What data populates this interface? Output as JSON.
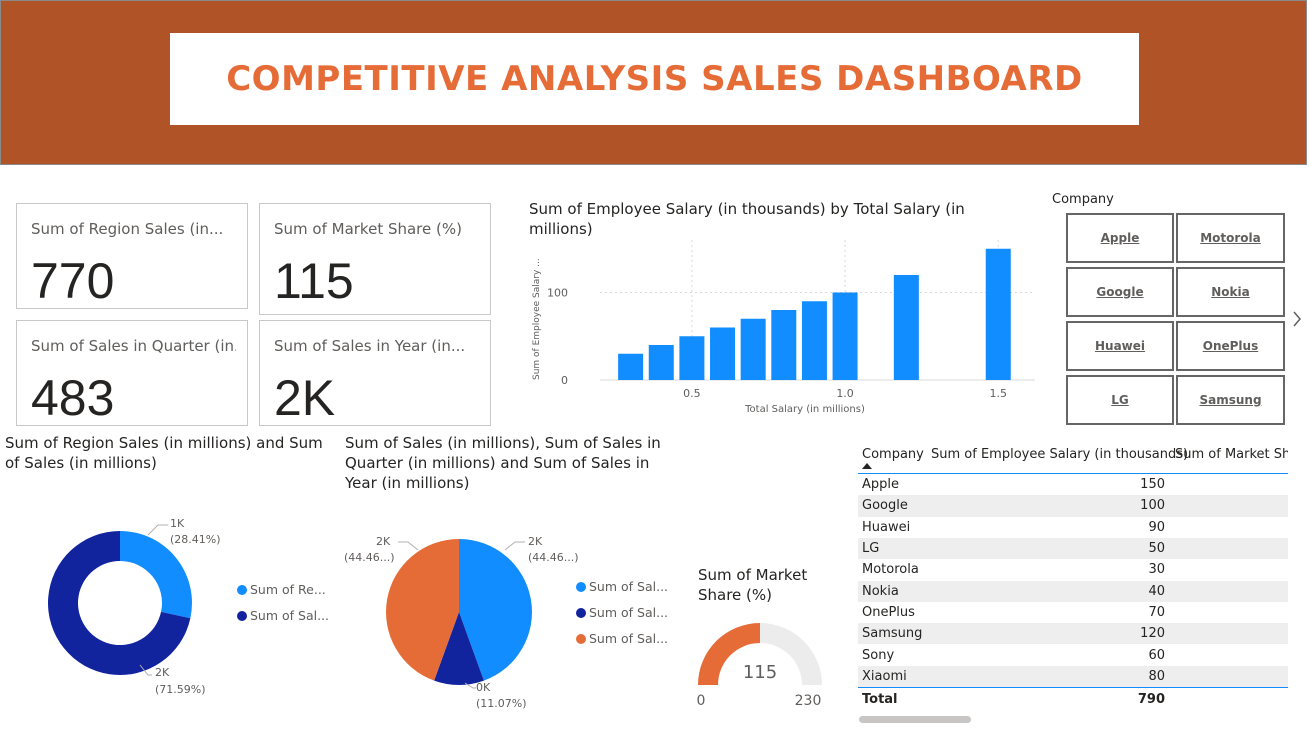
{
  "header": {
    "title": "COMPETITIVE ANALYSIS SALES DASHBOARD"
  },
  "cards": [
    {
      "label": "Sum of Region Sales (in...",
      "value": "770"
    },
    {
      "label": "Sum of Market Share (%)",
      "value": "115"
    },
    {
      "label": "Sum of Sales in Quarter (in...",
      "value": "483"
    },
    {
      "label": "Sum of Sales in Year (in...",
      "value": "2K"
    }
  ],
  "bar_chart": {
    "title_line1": "Sum of Employee Salary (in thousands) by Total Salary (in",
    "title_line2": "millions)",
    "xlabel": "Total Salary (in millions)",
    "ylabel": "Sum of Employee Salary ...",
    "x_ticks": [
      "0.5",
      "1.0",
      "1.5"
    ],
    "y_ticks": [
      "0",
      "100"
    ],
    "color": "#118dff"
  },
  "slicer": {
    "title": "Company",
    "items": [
      "Apple",
      "Motorola",
      "Google",
      "Nokia",
      "Huawei",
      "OnePlus",
      "LG",
      "Samsung"
    ]
  },
  "donut": {
    "title_line1": "Sum of Region Sales (in millions) and Sum",
    "title_line2": "of Sales (in millions)",
    "label_a_value": "1K",
    "label_a_pct": "(28.41%)",
    "label_b_value": "2K",
    "label_b_pct": "(71.59%)",
    "legend": [
      "Sum of Re...",
      "Sum of Sal..."
    ],
    "colors": [
      "#118dff",
      "#12239e"
    ]
  },
  "pie": {
    "title_line1": "Sum of Sales (in millions), Sum of Sales in",
    "title_line2": "Quarter (in millions) and Sum of Sales in",
    "title_line3": "Year (in millions)",
    "label_right_value": "2K",
    "label_right_pct": "(44.46...)",
    "label_left_value": "2K",
    "label_left_pct": "(44.46...)",
    "label_bottom_value": "0K",
    "label_bottom_pct": "(11.07%)",
    "legend": [
      "Sum of Sal...",
      "Sum of Sal...",
      "Sum of Sal..."
    ],
    "colors": [
      "#118dff",
      "#12239e",
      "#e66c37"
    ]
  },
  "gauge": {
    "title_line1": "Sum of Market",
    "title_line2": "Share (%)",
    "min": "0",
    "max": "230",
    "value": "115",
    "fill_color": "#e66c37"
  },
  "table": {
    "headers": [
      "Company",
      "Sum of Employee Salary (in thousands)",
      "Sum of Market Sha"
    ],
    "rows": [
      {
        "company": "Apple",
        "salary": "150"
      },
      {
        "company": "Google",
        "salary": "100"
      },
      {
        "company": "Huawei",
        "salary": "90"
      },
      {
        "company": "LG",
        "salary": "50"
      },
      {
        "company": "Motorola",
        "salary": "30"
      },
      {
        "company": "Nokia",
        "salary": "40"
      },
      {
        "company": "OnePlus",
        "salary": "70"
      },
      {
        "company": "Samsung",
        "salary": "120"
      },
      {
        "company": "Sony",
        "salary": "60"
      },
      {
        "company": "Xiaomi",
        "salary": "80"
      }
    ],
    "total_label": "Total",
    "total_value": "790"
  },
  "chart_data": [
    {
      "type": "bar",
      "title": "Sum of Employee Salary (in thousands) by Total Salary (in millions)",
      "xlabel": "Total Salary (in millions)",
      "ylabel": "Sum of Employee Salary ...",
      "x": [
        0.3,
        0.4,
        0.5,
        0.6,
        0.7,
        0.8,
        0.9,
        1.0,
        1.2,
        1.5
      ],
      "values": [
        30,
        40,
        50,
        60,
        70,
        80,
        90,
        100,
        120,
        150
      ],
      "xlim": [
        0.2,
        1.62
      ],
      "ylim": [
        0,
        160
      ],
      "grid": true
    },
    {
      "type": "pie",
      "title": "Sum of Region Sales (in millions) and Sum of Sales (in millions)",
      "categories": [
        "Sum of Re...",
        "Sum of Sal..."
      ],
      "values": [
        28.41,
        71.59
      ],
      "donut": true
    },
    {
      "type": "pie",
      "title": "Sum of Sales (in millions), Sum of Sales in Quarter (in millions) and Sum of Sales in Year (in millions)",
      "categories": [
        "Sum of Sal...",
        "Sum of Sal...",
        "Sum of Sal..."
      ],
      "values": [
        44.46,
        11.07,
        44.46
      ]
    }
  ]
}
